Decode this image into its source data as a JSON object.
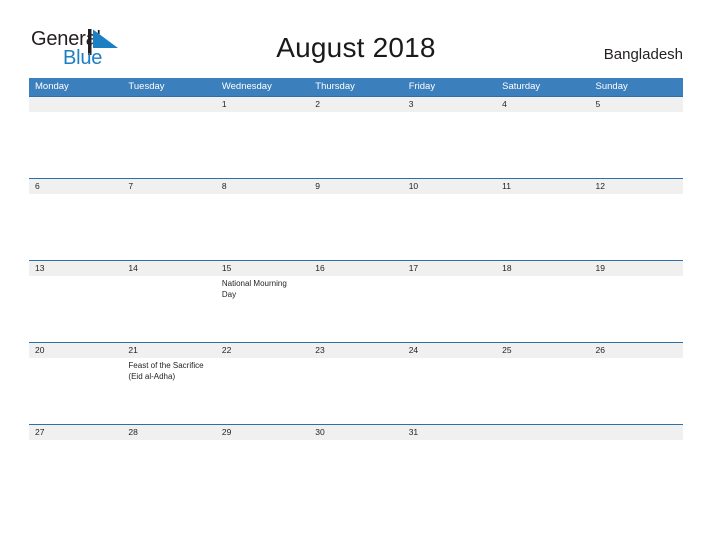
{
  "brand": {
    "name_part1": "General",
    "name_part2": "Blue",
    "mark_icon": "flag-triangle-icon",
    "accent_color": "#1c7fc4"
  },
  "header": {
    "title": "August 2018",
    "country": "Bangladesh"
  },
  "calendar": {
    "header_bg_color": "#3c7fbd",
    "date_band_color": "#f0f0f0",
    "row_line_color": "#2f6fa8",
    "day_names": [
      "Monday",
      "Tuesday",
      "Wednesday",
      "Thursday",
      "Friday",
      "Saturday",
      "Sunday"
    ],
    "weeks": [
      [
        {
          "date": "",
          "event": ""
        },
        {
          "date": "",
          "event": ""
        },
        {
          "date": "1",
          "event": ""
        },
        {
          "date": "2",
          "event": ""
        },
        {
          "date": "3",
          "event": ""
        },
        {
          "date": "4",
          "event": ""
        },
        {
          "date": "5",
          "event": ""
        }
      ],
      [
        {
          "date": "6",
          "event": ""
        },
        {
          "date": "7",
          "event": ""
        },
        {
          "date": "8",
          "event": ""
        },
        {
          "date": "9",
          "event": ""
        },
        {
          "date": "10",
          "event": ""
        },
        {
          "date": "11",
          "event": ""
        },
        {
          "date": "12",
          "event": ""
        }
      ],
      [
        {
          "date": "13",
          "event": ""
        },
        {
          "date": "14",
          "event": ""
        },
        {
          "date": "15",
          "event": "National Mourning Day"
        },
        {
          "date": "16",
          "event": ""
        },
        {
          "date": "17",
          "event": ""
        },
        {
          "date": "18",
          "event": ""
        },
        {
          "date": "19",
          "event": ""
        }
      ],
      [
        {
          "date": "20",
          "event": ""
        },
        {
          "date": "21",
          "event": "Feast of the Sacrifice (Eid al-Adha)"
        },
        {
          "date": "22",
          "event": ""
        },
        {
          "date": "23",
          "event": ""
        },
        {
          "date": "24",
          "event": ""
        },
        {
          "date": "25",
          "event": ""
        },
        {
          "date": "26",
          "event": ""
        }
      ],
      [
        {
          "date": "27",
          "event": ""
        },
        {
          "date": "28",
          "event": ""
        },
        {
          "date": "29",
          "event": ""
        },
        {
          "date": "30",
          "event": ""
        },
        {
          "date": "31",
          "event": ""
        },
        {
          "date": "",
          "event": ""
        },
        {
          "date": "",
          "event": ""
        }
      ]
    ]
  }
}
